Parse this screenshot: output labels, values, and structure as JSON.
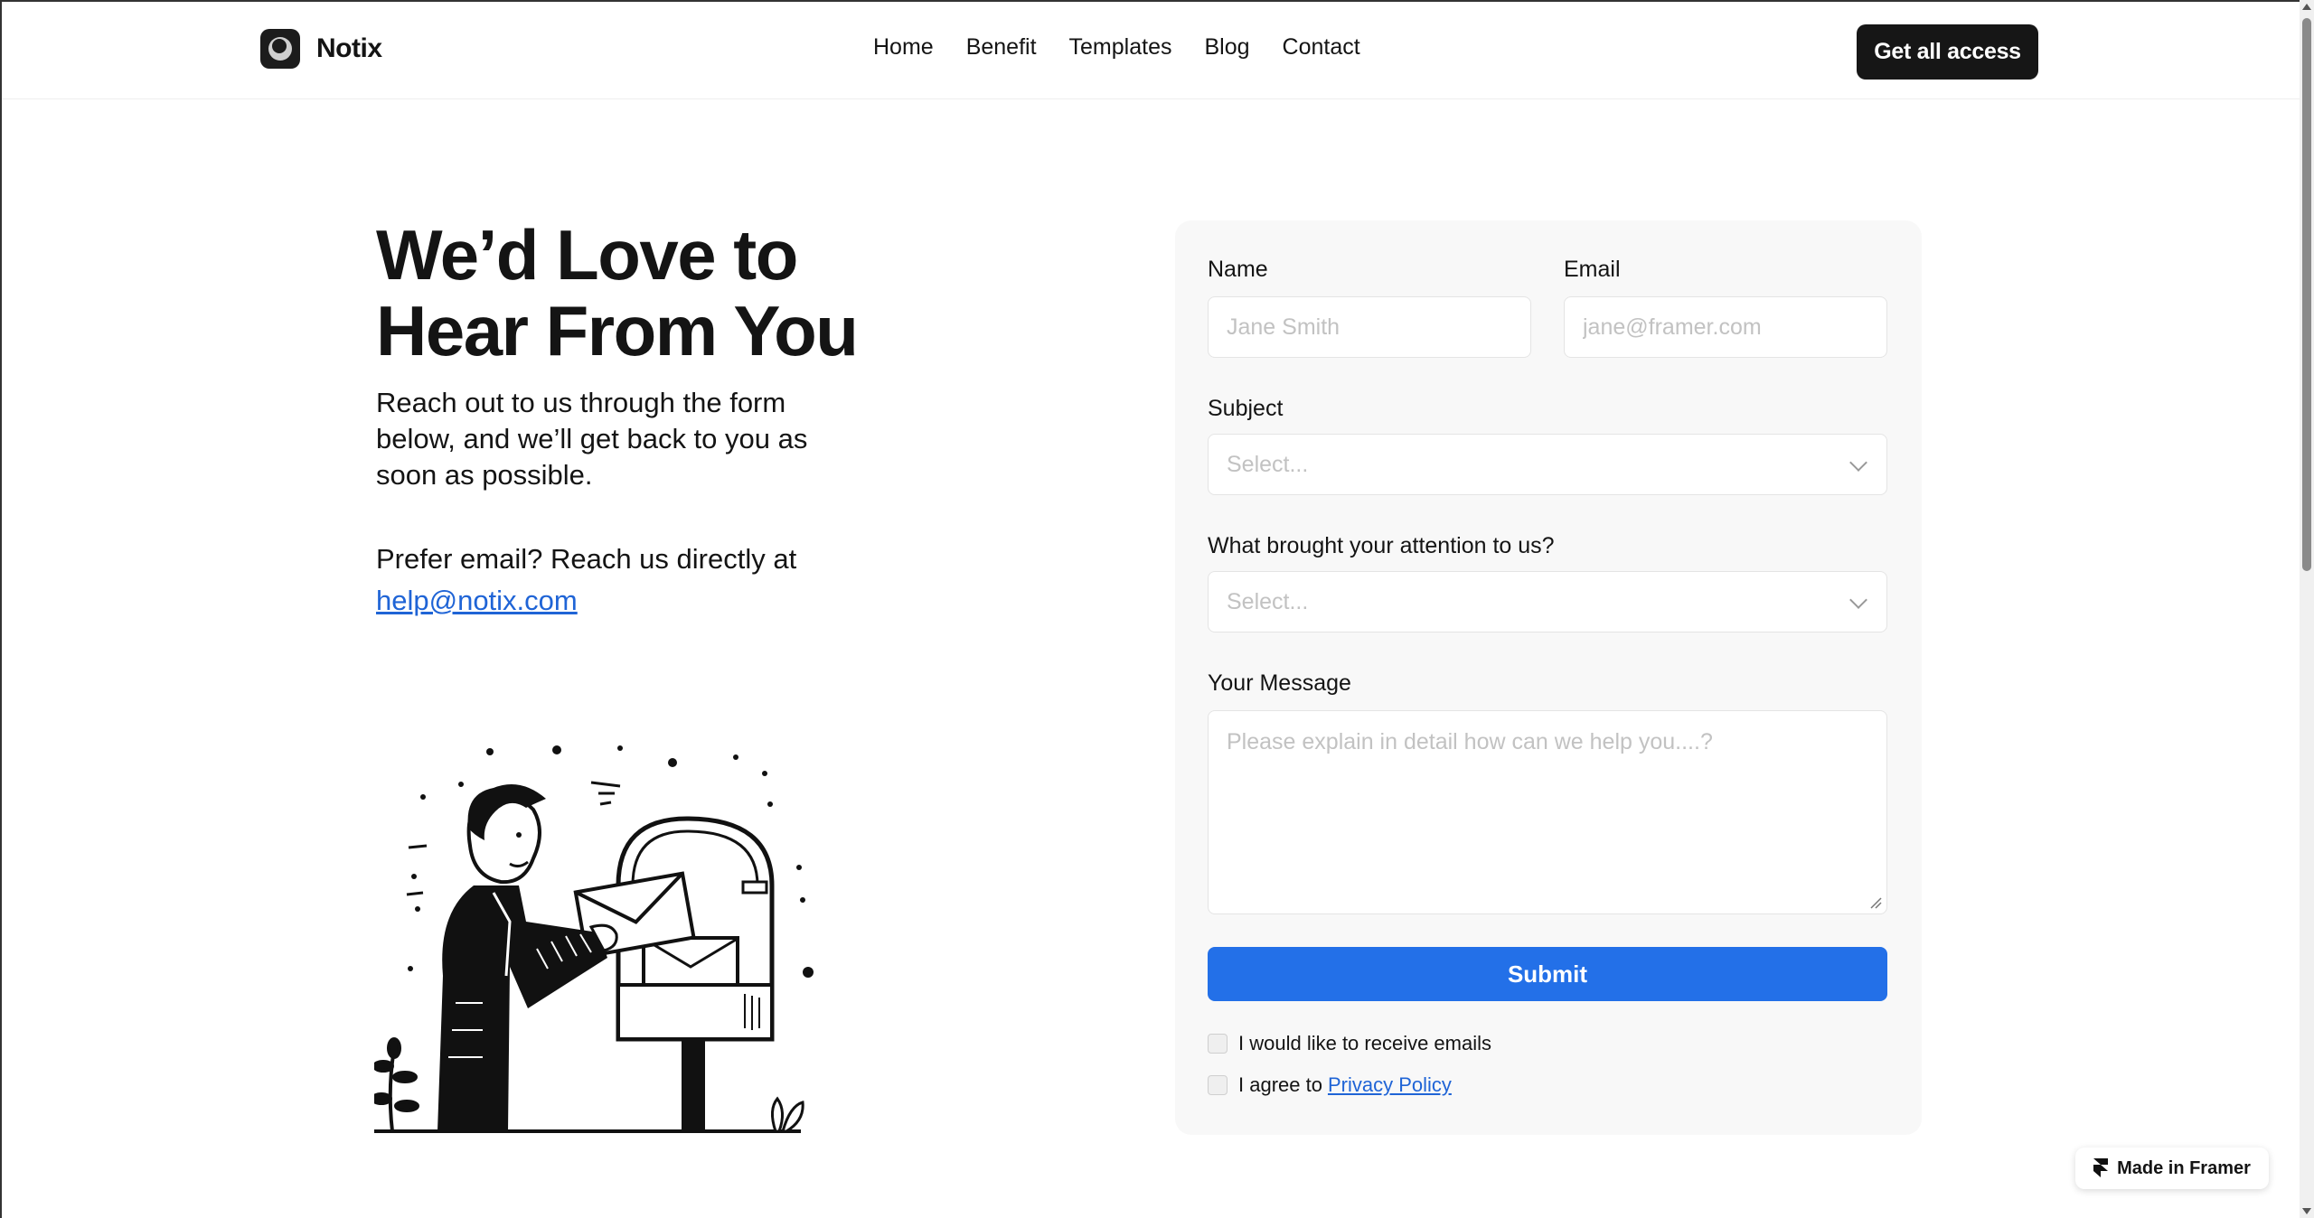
{
  "header": {
    "brand": "Notix",
    "nav": [
      {
        "label": "Home"
      },
      {
        "label": "Benefit"
      },
      {
        "label": "Templates"
      },
      {
        "label": "Blog"
      },
      {
        "label": "Contact"
      }
    ],
    "cta_label": "Get all access"
  },
  "hero": {
    "title": "We’d Love to Hear From You",
    "description": "Reach out to us through the form below, and we’ll get back to you as soon as possible.",
    "email_prefix": "Prefer email? Reach us directly at",
    "email": "help@notix.com",
    "illustration_icon": "person-mailbox-illustration"
  },
  "form": {
    "name_label": "Name",
    "name_placeholder": "Jane Smith",
    "email_label": "Email",
    "email_placeholder": "jane@framer.com",
    "subject_label": "Subject",
    "subject_value": "Select...",
    "attention_label": "What brought your attention to us?",
    "attention_value": "Select...",
    "message_label": "Your Message",
    "message_placeholder": "Please explain in detail how can we help you....?",
    "submit_label": "Submit",
    "receive_emails_label": "I would like to receive emails",
    "agree_prefix": "I agree to",
    "privacy_link": "Privacy Policy"
  },
  "badge": {
    "label": "Made in Framer",
    "icon": "framer-logo-icon"
  },
  "colors": {
    "accent": "#2370e8",
    "link": "#1f64d6",
    "dark": "#161616",
    "card_bg": "#f8f8f8"
  }
}
